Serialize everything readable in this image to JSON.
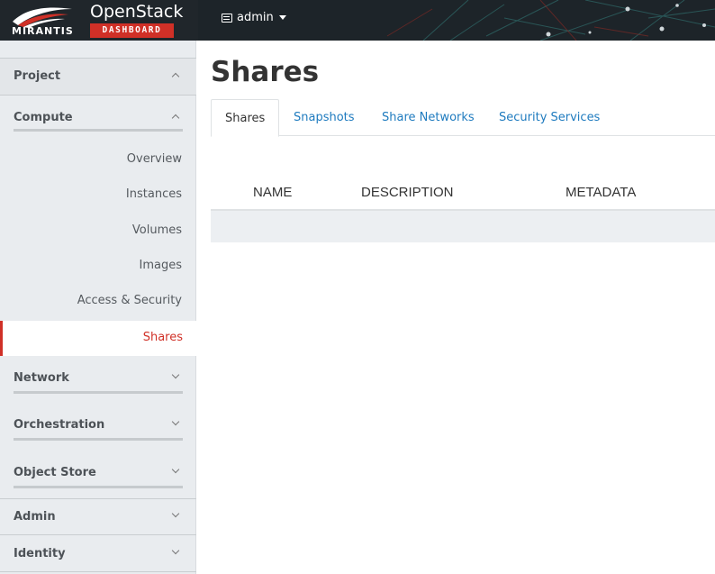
{
  "brand": {
    "company": "MIRANTIS",
    "product": "OpenStack",
    "badge": "DASHBOARD"
  },
  "user_menu": {
    "label": "admin",
    "icon": "user-card-icon"
  },
  "sidebar": {
    "sections": [
      {
        "label": "Project",
        "expanded": true
      },
      {
        "label": "Compute",
        "expanded": true,
        "items": [
          "Overview",
          "Instances",
          "Volumes",
          "Images",
          "Access & Security",
          "Shares"
        ],
        "active": "Shares"
      },
      {
        "label": "Network",
        "expanded": false
      },
      {
        "label": "Orchestration",
        "expanded": false
      },
      {
        "label": "Object Store",
        "expanded": false
      },
      {
        "label": "Admin",
        "expanded": false
      },
      {
        "label": "Identity",
        "expanded": false
      }
    ]
  },
  "page": {
    "title": "Shares"
  },
  "tabs": [
    {
      "label": "Shares",
      "active": true
    },
    {
      "label": "Snapshots",
      "active": false
    },
    {
      "label": "Share Networks",
      "active": false
    },
    {
      "label": "Security Services",
      "active": false
    }
  ],
  "table": {
    "columns": [
      "NAME",
      "DESCRIPTION",
      "METADATA"
    ],
    "rows": []
  },
  "colors": {
    "accent": "#d03027",
    "link": "#1f7bbf",
    "sidebar_bg": "#e9ecef",
    "topbar_bg": "#1c2328"
  }
}
